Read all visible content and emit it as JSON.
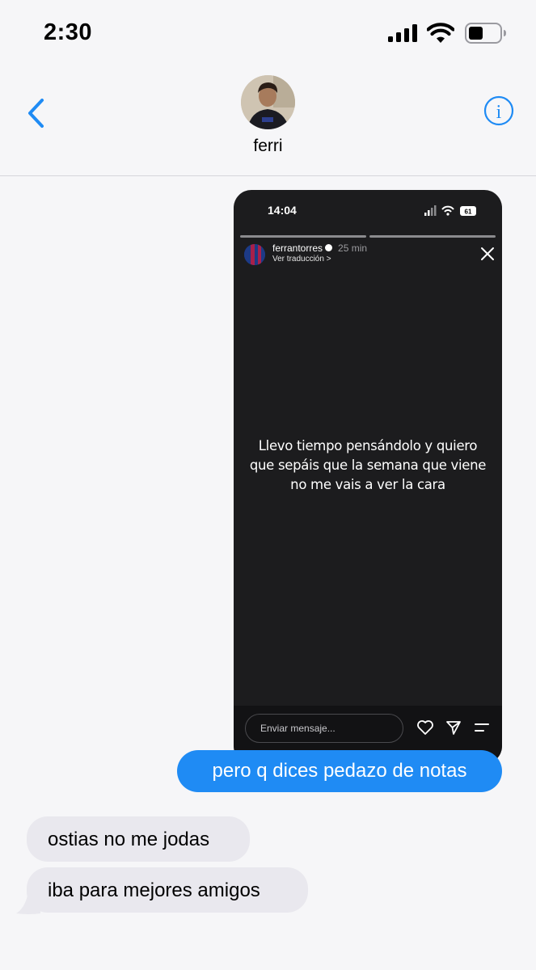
{
  "status_bar": {
    "time": "2:30",
    "signal_icon": "cellular-signal-icon",
    "wifi_icon": "wifi-icon",
    "battery_icon": "battery-icon"
  },
  "header": {
    "contact_name": "ferri",
    "back_icon": "chevron-left-icon",
    "info_icon": "info-icon"
  },
  "colors": {
    "accent": "#1f8bf4",
    "incoming_bubble": "#e9e8ee",
    "background": "#f6f6f8"
  },
  "screenshot": {
    "time": "14:04",
    "battery_label": "61",
    "username": "ferrantorres",
    "time_ago": "25 min",
    "translate": "Ver traducción >",
    "story_lines": [
      "Llevo tiempo pensándolo y quiero",
      "que sepáis que la semana que viene",
      "no me vais a ver la cara"
    ],
    "input_placeholder": "Enviar mensaje..."
  },
  "messages": {
    "outgoing": "pero q dices pedazo de notas",
    "incoming": [
      "ostias no me jodas",
      "iba para mejores amigos"
    ]
  }
}
